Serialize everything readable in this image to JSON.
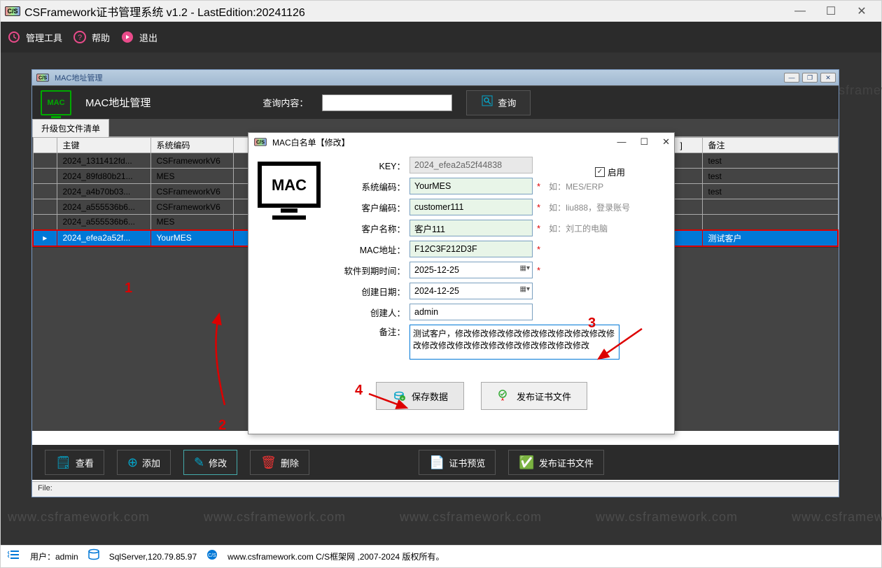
{
  "window": {
    "title": "CSFramework证书管理系统 v1.2 - LastEdition:20241126"
  },
  "menu": {
    "admin_tools": "管理工具",
    "help": "帮助",
    "exit": "退出"
  },
  "mdi": {
    "title": "MAC地址管理",
    "header_title": "MAC地址管理",
    "search_label": "查询内容：",
    "search_btn": "查询",
    "tab": "升级包文件清单",
    "status": "File:",
    "columns": {
      "pk": "主键",
      "sys": "系统编码",
      "note": "备注"
    },
    "rows": [
      {
        "pk": "2024_1311412fd...",
        "sys": "CSFrameworkV6",
        "note": "test"
      },
      {
        "pk": "2024_89fd80b21...",
        "sys": "MES",
        "note": "test"
      },
      {
        "pk": "2024_a4b70b03...",
        "sys": "CSFrameworkV6",
        "note": "test"
      },
      {
        "pk": "2024_a555536b6...",
        "sys": "CSFrameworkV6",
        "note": ""
      },
      {
        "pk": "2024_a555536b6...",
        "sys": "MES",
        "note": ""
      },
      {
        "pk": "2024_efea2a52f...",
        "sys": "YourMES",
        "note": "测试客户"
      }
    ],
    "toolbar": {
      "view": "查看",
      "add": "添加",
      "edit": "修改",
      "delete": "删除",
      "preview": "证书预览",
      "publish": "发布证书文件"
    }
  },
  "dialog": {
    "title": "MAC白名单【修改】",
    "labels": {
      "key": "KEY：",
      "syscode": "系统编码：",
      "custcode": "客户编码：",
      "custname": "客户名称：",
      "mac": "MAC地址：",
      "expire": "软件到期时间：",
      "create_date": "创建日期：",
      "creator": "创建人：",
      "remark": "备注："
    },
    "values": {
      "key": "2024_efea2a52f44838",
      "syscode": "YourMES",
      "custcode": "customer111",
      "custname": "客户111",
      "mac": "F12C3F212D3F",
      "expire": "2025-12-25",
      "create_date": "2024-12-25",
      "creator": "admin",
      "remark": "测试客户，修改修改修改修改修改修改修改修改修改修改修改修改修改修改修改修改修改修改修改修改"
    },
    "hints": {
      "syscode": "如：MES/ERP",
      "custcode": "如：liu888，登录账号",
      "custname": "如：刘工的电脑"
    },
    "enable_label": "启用",
    "buttons": {
      "save": "保存数据",
      "publish": "发布证书文件"
    }
  },
  "status": {
    "user": "用户：admin",
    "db": "SqlServer,120.79.85.97",
    "site": "www.csframework.com C/S框架网 ,2007-2024 版权所有。"
  },
  "watermark": "www.csframework.com",
  "annotations": {
    "a1": "1",
    "a2": "2",
    "a3": "3",
    "a4": "4"
  }
}
